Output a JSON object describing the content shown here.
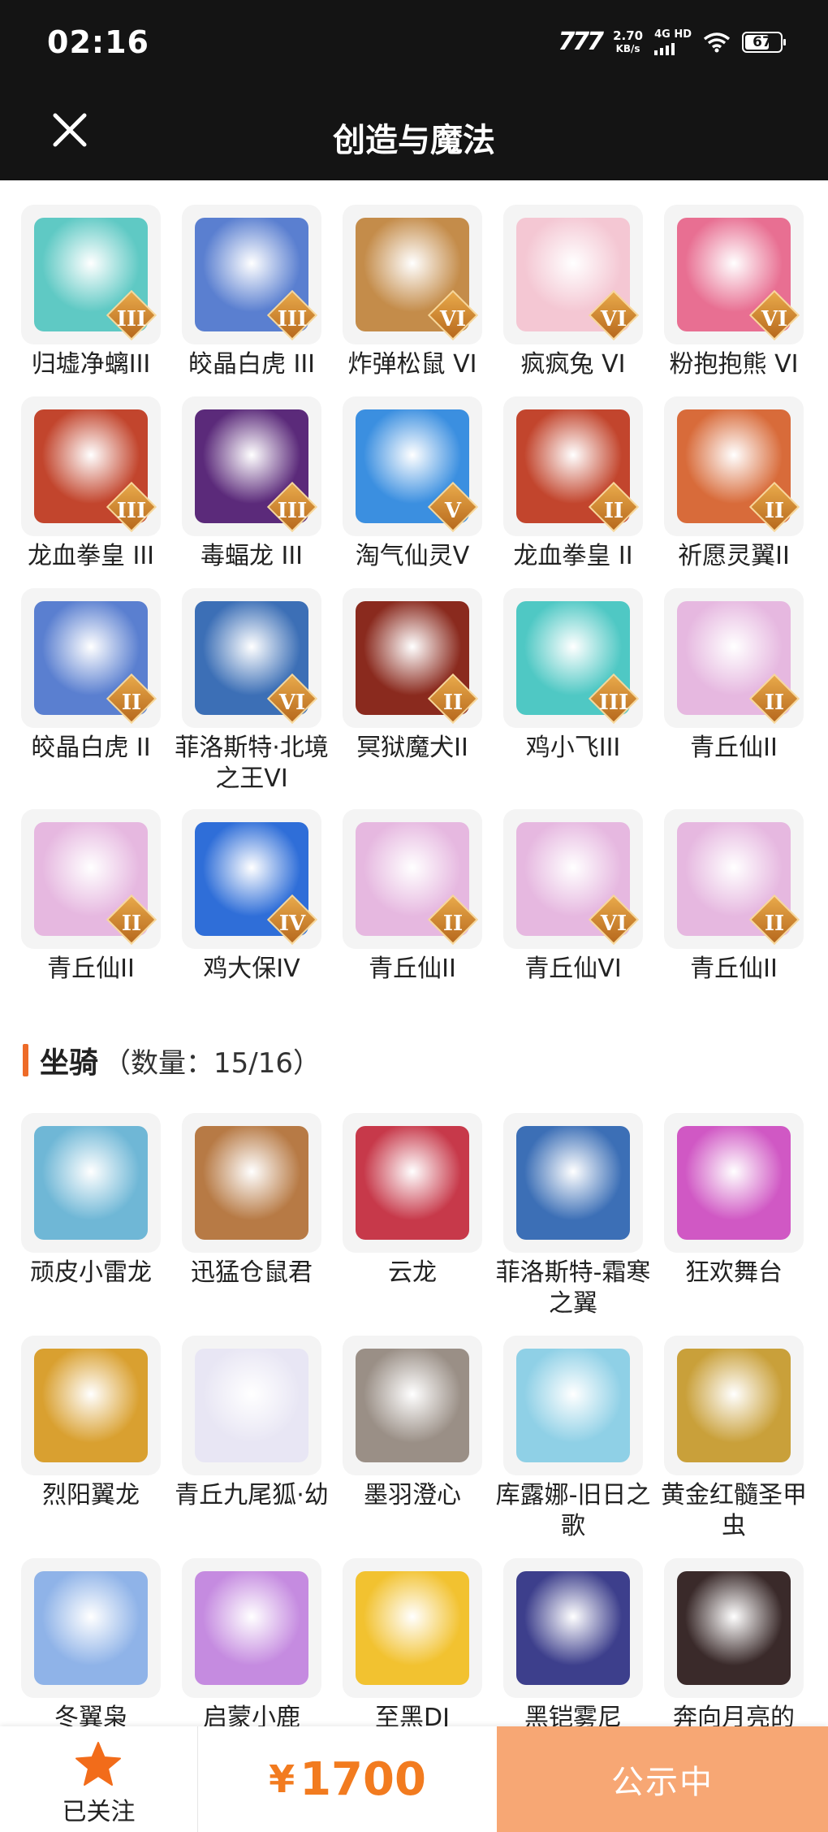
{
  "status_bar": {
    "time": "02:16",
    "carrier_logo": "777",
    "speed": "2.70",
    "speed_unit": "KB/s",
    "network": "4G HD",
    "battery": "67"
  },
  "header": {
    "title": "创造与魔法"
  },
  "pets": [
    {
      "name": "归墟净螭III",
      "tier": "III",
      "color": "#5fc9c4"
    },
    {
      "name": "皎晶白虎 III",
      "tier": "III",
      "color": "#5a7fd0"
    },
    {
      "name": "炸弹松鼠 VI",
      "tier": "VI",
      "color": "#c48c4a"
    },
    {
      "name": "疯疯兔 VI",
      "tier": "VI",
      "color": "#f4c7d3"
    },
    {
      "name": "粉抱抱熊 VI",
      "tier": "VI",
      "color": "#e86f92"
    },
    {
      "name": "龙血拳皇 III",
      "tier": "III",
      "color": "#c2452d"
    },
    {
      "name": "毒蝠龙 III",
      "tier": "III",
      "color": "#5b2a7a"
    },
    {
      "name": "淘气仙灵V",
      "tier": "V",
      "color": "#3b8fe0"
    },
    {
      "name": "龙血拳皇 II",
      "tier": "II",
      "color": "#c2452d"
    },
    {
      "name": "祈愿灵翼II",
      "tier": "II",
      "color": "#d86b3a"
    },
    {
      "name": "皎晶白虎 II",
      "tier": "II",
      "color": "#5a7fd0"
    },
    {
      "name": "菲洛斯特·北境之王VI",
      "tier": "VI",
      "color": "#3c6fb6"
    },
    {
      "name": "冥狱魔犬II",
      "tier": "II",
      "color": "#8a2a1e"
    },
    {
      "name": "鸡小飞III",
      "tier": "III",
      "color": "#4fc8c4"
    },
    {
      "name": "青丘仙II",
      "tier": "II",
      "color": "#e6b8e0"
    },
    {
      "name": "青丘仙II",
      "tier": "II",
      "color": "#e6b8e0"
    },
    {
      "name": "鸡大保IV",
      "tier": "IV",
      "color": "#2f6ed8"
    },
    {
      "name": "青丘仙II",
      "tier": "II",
      "color": "#e6b8e0"
    },
    {
      "name": "青丘仙VI",
      "tier": "VI",
      "color": "#e6b8e0"
    },
    {
      "name": "青丘仙II",
      "tier": "II",
      "color": "#e6b8e0"
    }
  ],
  "mounts_section": {
    "title": "坐骑",
    "count": "（数量：15/16）"
  },
  "mounts": [
    {
      "name": "顽皮小雷龙",
      "color": "#6fb7d6"
    },
    {
      "name": "迅猛仓鼠君",
      "color": "#b77a45"
    },
    {
      "name": "云龙",
      "color": "#c7394a"
    },
    {
      "name": "菲洛斯特-霜寒之翼",
      "color": "#3c6fb6"
    },
    {
      "name": "狂欢舞台",
      "color": "#d058c4"
    },
    {
      "name": "烈阳翼龙",
      "color": "#d9a030"
    },
    {
      "name": "青丘九尾狐·幼",
      "color": "#e8e6f4"
    },
    {
      "name": "墨羽澄心",
      "color": "#9a8f86"
    },
    {
      "name": "库露娜-旧日之歌",
      "color": "#8fd0e6"
    },
    {
      "name": "黄金红髓圣甲虫",
      "color": "#c9a03a"
    },
    {
      "name": "冬翼枭",
      "color": "#8fb3e8"
    },
    {
      "name": "启蒙小鹿",
      "color": "#c58be0"
    },
    {
      "name": "至黑DJ",
      "color": "#f2c230"
    },
    {
      "name": "黑铠雾尼",
      "color": "#3d3f8c"
    },
    {
      "name": "奔向月亮的",
      "color": "#3a2a2a"
    }
  ],
  "bottom_bar": {
    "follow_label": "已关注",
    "currency": "¥",
    "price": "1700",
    "status_button": "公示中"
  },
  "colors": {
    "accent": "#f27b1f",
    "button": "#f7a774",
    "header_bg": "#141414",
    "section_bar": "#ee6b28"
  },
  "icons": {
    "close": "close-icon",
    "follow": "star-icon"
  }
}
